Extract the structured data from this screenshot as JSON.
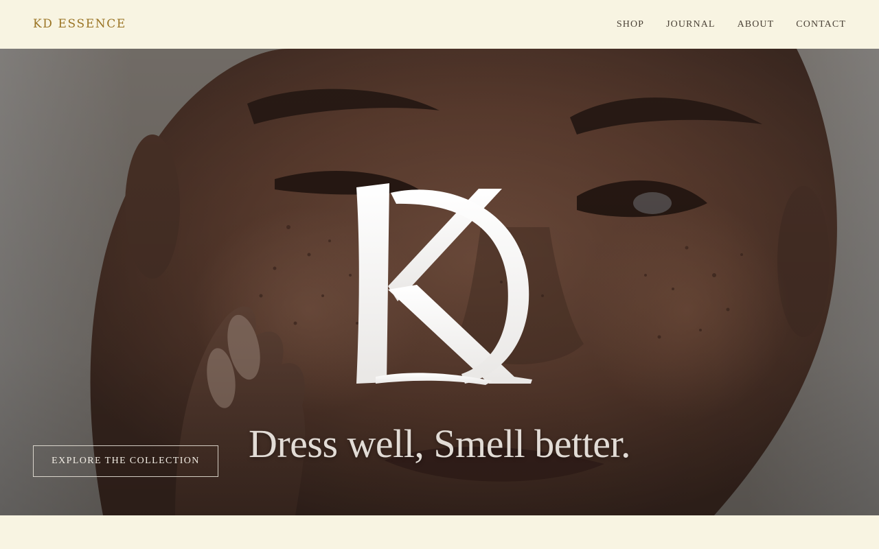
{
  "header": {
    "brand": "KD ESSENCE",
    "nav": [
      {
        "label": "SHOP"
      },
      {
        "label": "JOURNAL"
      },
      {
        "label": "ABOUT"
      },
      {
        "label": "CONTACT"
      }
    ]
  },
  "hero": {
    "logo_monogram": "KD",
    "tagline": "Dress well, Smell better.",
    "cta_label": "EXPLORE THE COLLECTION",
    "image_subject": "close-up portrait of a smiling woman with freckles, hand on cheek"
  },
  "colors": {
    "background": "#f8f4e2",
    "brand_gold": "#9a7424",
    "nav_text": "#4a4136",
    "hero_text": "#e2dcd6"
  }
}
